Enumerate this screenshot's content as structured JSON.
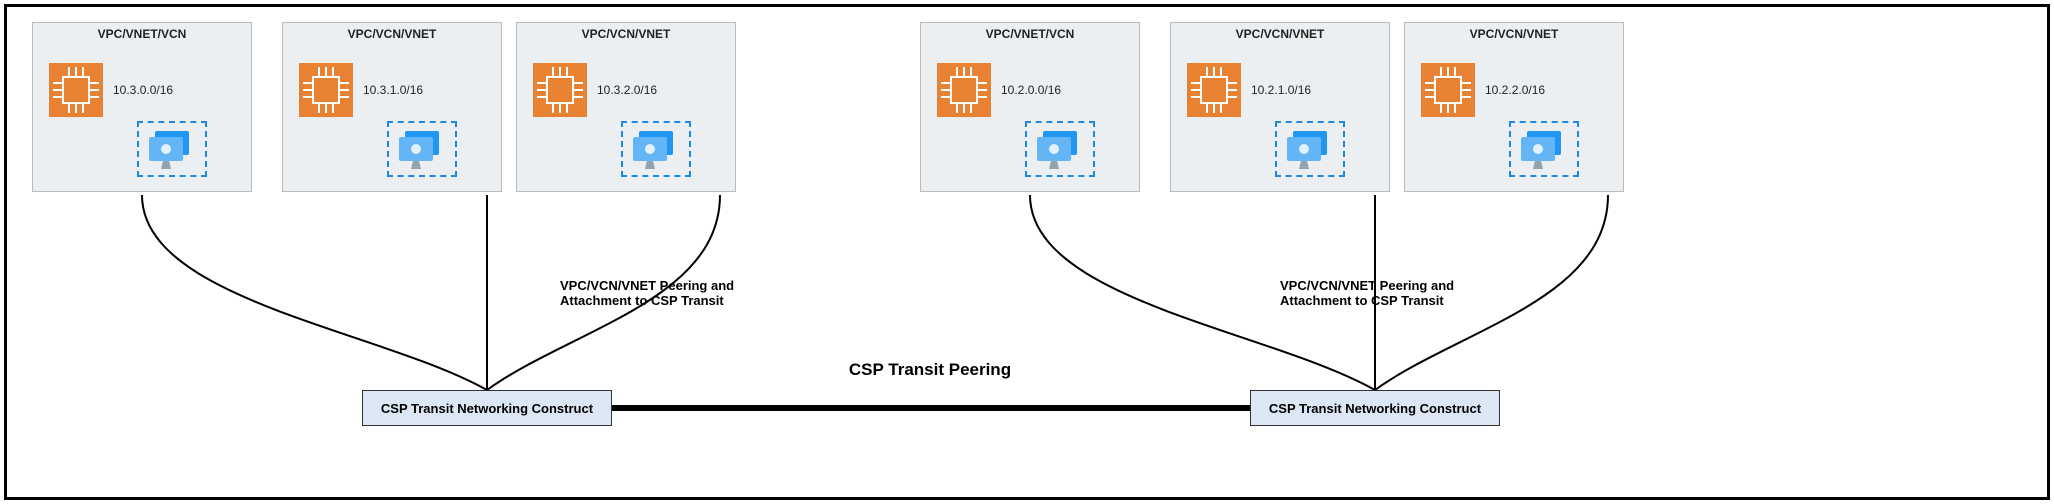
{
  "vpc_boxes": [
    {
      "title": "VPC/VNET/VCN",
      "cidr": "10.3.0.0/16"
    },
    {
      "title": "VPC/VCN/VNET",
      "cidr": "10.3.1.0/16"
    },
    {
      "title": "VPC/VCN/VNET",
      "cidr": "10.3.2.0/16"
    },
    {
      "title": "VPC/VNET/VCN",
      "cidr": "10.2.0.0/16"
    },
    {
      "title": "VPC/VCN/VNET",
      "cidr": "10.2.1.0/16"
    },
    {
      "title": "VPC/VCN/VNET",
      "cidr": "10.2.2.0/16"
    }
  ],
  "transit_left": "CSP Transit Networking Construct",
  "transit_right": "CSP Transit Networking Construct",
  "peering_label_line1": "VPC/VCN/VNET Peering and",
  "peering_label_line2": "Attachment to CSP Transit",
  "center_label": "CSP Transit Peering",
  "icons": {
    "cpu": "cpu-chip-icon",
    "vm": "vm-display-icon"
  },
  "colors": {
    "vpc_bg": "#eceff1",
    "transit_bg": "#dbe7f5",
    "cpu_fill": "#e98132",
    "vm_fill": "#2a9fd6",
    "dashed_border": "#1e88e5"
  },
  "chart_data": {
    "type": "diagram",
    "title": "CSP Transit Peering",
    "nodes": [
      {
        "id": "vpc1",
        "label": "VPC/VNET/VCN",
        "cidr": "10.3.0.0/16",
        "group": "left"
      },
      {
        "id": "vpc2",
        "label": "VPC/VCN/VNET",
        "cidr": "10.3.1.0/16",
        "group": "left"
      },
      {
        "id": "vpc3",
        "label": "VPC/VCN/VNET",
        "cidr": "10.3.2.0/16",
        "group": "left"
      },
      {
        "id": "vpc4",
        "label": "VPC/VNET/VCN",
        "cidr": "10.2.0.0/16",
        "group": "right"
      },
      {
        "id": "vpc5",
        "label": "VPC/VCN/VNET",
        "cidr": "10.2.1.0/16",
        "group": "right"
      },
      {
        "id": "vpc6",
        "label": "VPC/VCN/VNET",
        "cidr": "10.2.2.0/16",
        "group": "right"
      },
      {
        "id": "transitL",
        "label": "CSP Transit Networking Construct",
        "group": "left"
      },
      {
        "id": "transitR",
        "label": "CSP Transit Networking Construct",
        "group": "right"
      }
    ],
    "edges": [
      {
        "from": "vpc1",
        "to": "transitL",
        "label": "VPC/VCN/VNET Peering and Attachment to CSP Transit"
      },
      {
        "from": "vpc2",
        "to": "transitL"
      },
      {
        "from": "vpc3",
        "to": "transitL"
      },
      {
        "from": "vpc4",
        "to": "transitR",
        "label": "VPC/VCN/VNET Peering and Attachment to CSP Transit"
      },
      {
        "from": "vpc5",
        "to": "transitR"
      },
      {
        "from": "vpc6",
        "to": "transitR"
      },
      {
        "from": "transitL",
        "to": "transitR",
        "label": "CSP Transit Peering"
      }
    ]
  }
}
